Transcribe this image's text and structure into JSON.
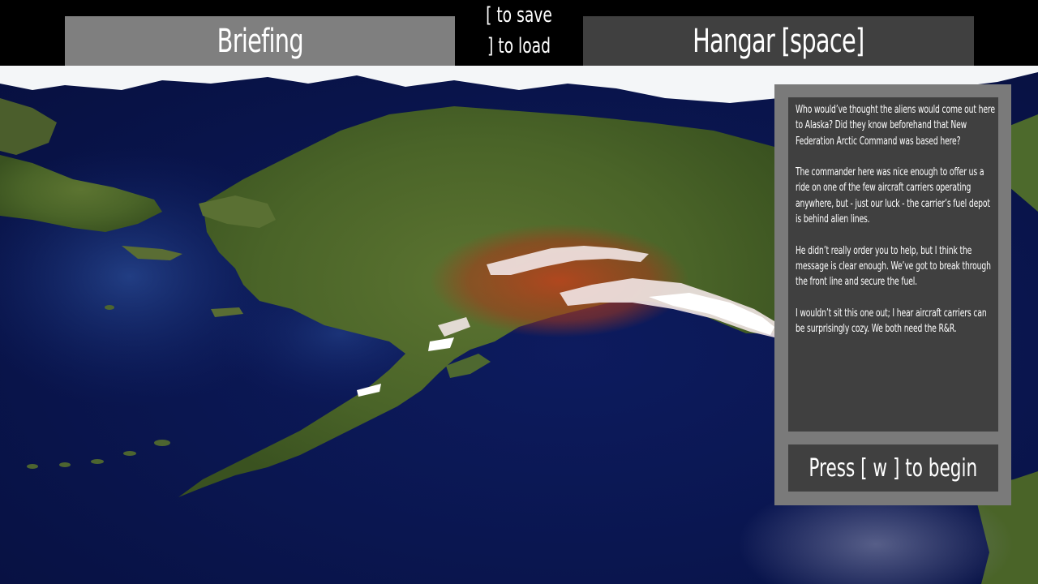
{
  "header": {
    "briefing_tab": "Briefing",
    "save_hint": "[ to save",
    "load_hint": "] to load",
    "hangar_tab": "Hangar [space]"
  },
  "briefing": {
    "paragraphs": [
      "Who would’ve thought the aliens would come out here to Alaska? Did they know beforehand that New Federation Arctic Command was based here?",
      "The commander here was nice enough to offer us a ride on one of the few aircraft carriers operating anywhere, but - just our luck - the carrier’s fuel depot is behind alien lines.",
      "He didn’t really order you to help, but I think the message is clear enough. We’ve got to break through the front line and secure the fuel.",
      "I wouldn’t sit this one out; I hear aircraft carriers can be surprisingly cozy. We both need the R&R."
    ],
    "begin_label": "Press [ w ] to begin"
  },
  "map": {
    "region": "Alaska",
    "colors": {
      "ocean": "#0a1650",
      "land": "#4f6a2c",
      "ice": "#ffffff",
      "alien_zone": "#b04020"
    }
  },
  "colors": {
    "briefing_tab_bg": "#7f7f7f",
    "hangar_tab_bg": "#404040",
    "panel_border": "#7a7a7a",
    "panel_bg": "#404040",
    "text": "#ffffff"
  }
}
